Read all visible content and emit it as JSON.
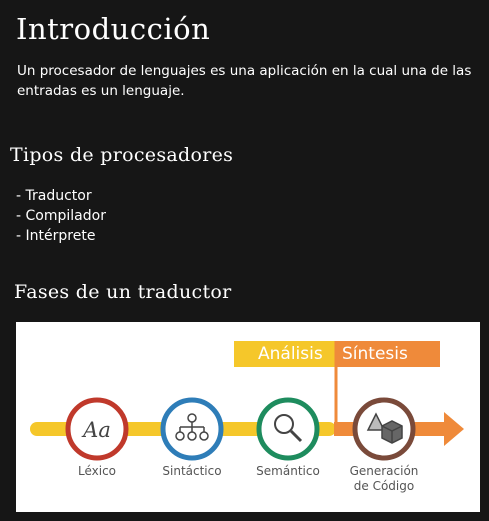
{
  "title": "Introducción",
  "intro": "Un procesador de lenguajes es una aplicación en la cual una de las entradas es un lenguaje.",
  "types": {
    "heading": "Tipos de procesadores",
    "items": [
      "Traductor",
      "Compilador",
      "Intérprete"
    ]
  },
  "phases": {
    "heading": "Fases de un traductor",
    "analysis_label": "Análisis",
    "synthesis_label": "Síntesis",
    "steps": [
      {
        "label": "Léxico",
        "icon": "text-aa-icon",
        "color": "#c0392b"
      },
      {
        "label": "Sintáctico",
        "icon": "tree-icon",
        "color": "#2e7db8"
      },
      {
        "label": "Semántico",
        "icon": "magnifier-icon",
        "color": "#1e8c5e"
      },
      {
        "label_line1": "Generación",
        "label_line2": "de Código",
        "icon": "shapes-icon",
        "color": "#7a4a3a"
      }
    ],
    "colors": {
      "analysis": "#f5c72a",
      "synthesis": "#ef8a3a"
    }
  }
}
